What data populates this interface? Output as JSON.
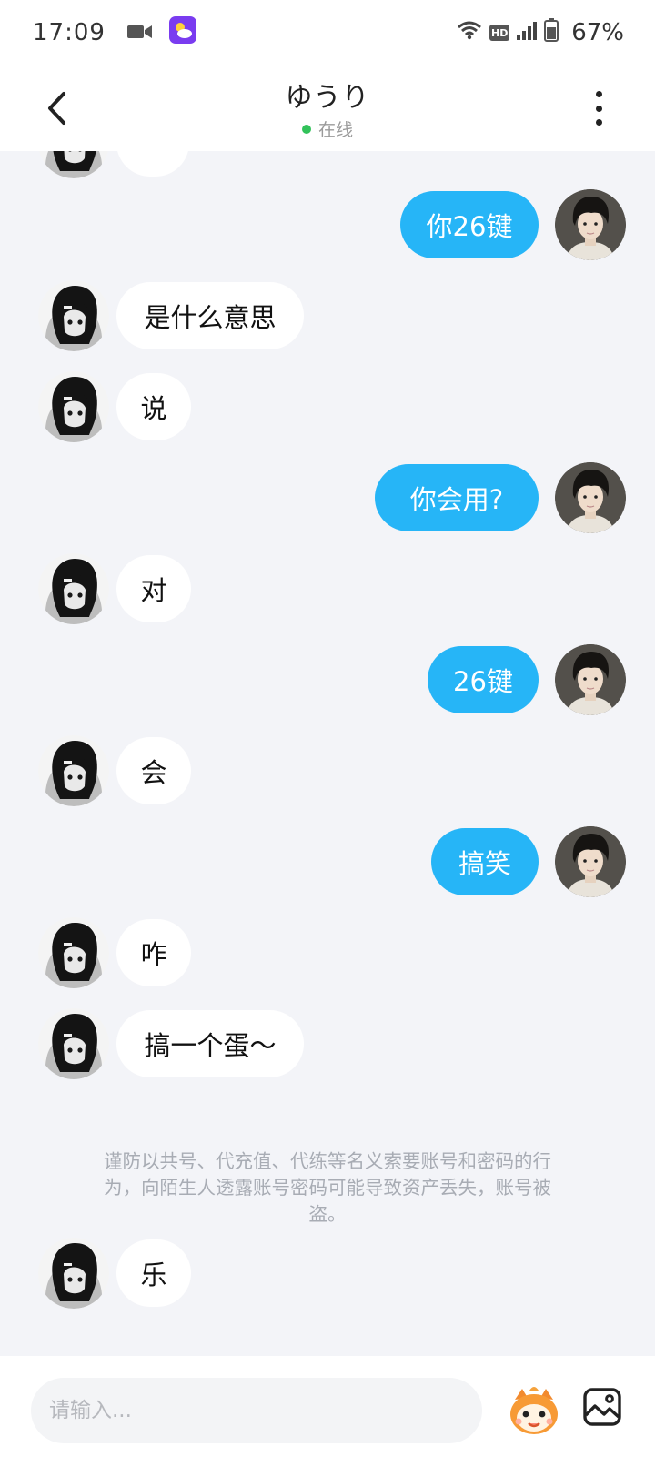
{
  "status_bar": {
    "time": "17:09",
    "network": "HD",
    "battery": "67%"
  },
  "header": {
    "contact_name": "ゆうり",
    "online_status": "在线"
  },
  "messages": [
    {
      "sender": "me",
      "text": "你26键"
    },
    {
      "sender": "her",
      "text": "是什么意思"
    },
    {
      "sender": "her",
      "text": "说"
    },
    {
      "sender": "me",
      "text": "你会用?"
    },
    {
      "sender": "her",
      "text": "对"
    },
    {
      "sender": "me",
      "text": "26键"
    },
    {
      "sender": "her",
      "text": "会"
    },
    {
      "sender": "me",
      "text": "搞笑"
    },
    {
      "sender": "her",
      "text": "咋"
    },
    {
      "sender": "her",
      "text": "搞一个蛋～"
    },
    {
      "sender": "her",
      "text": "乐"
    }
  ],
  "notice": {
    "line1": "谨防以共号、代充值、代练等名义索要账号和密码的行",
    "line2": "为，向陌生人透露账号密码可能导致资产丢失，账号被",
    "line3": "盗。"
  },
  "input": {
    "placeholder": "请输入..."
  },
  "colors": {
    "outgoing_bubble": "#26b5f7",
    "incoming_bubble": "#ffffff",
    "chat_background": "#f3f4f8",
    "online_dot": "#32c25a"
  }
}
